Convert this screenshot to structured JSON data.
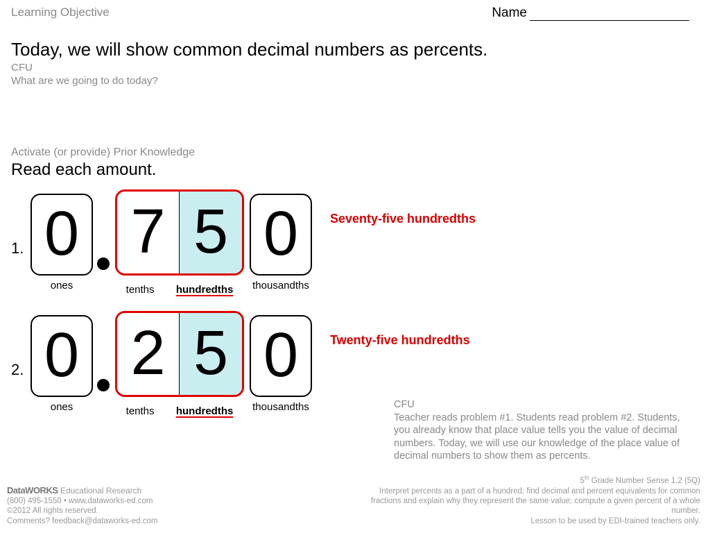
{
  "header": {
    "learning_objective_label": "Learning Objective",
    "name_label": "Name"
  },
  "objective": "Today, we will show common decimal numbers as percents.",
  "cfu1_label": "CFU",
  "cfu1_text": "What are we going to do today?",
  "prior_knowledge_label": "Activate (or provide) Prior Knowledge",
  "read_each": "Read each amount.",
  "problems": [
    {
      "num": "1.",
      "ones": "0",
      "tenths": "7",
      "hundredths": "5",
      "thousandths": "0",
      "labels": {
        "ones": "ones",
        "tenths": "tenths",
        "hundredths": "hundredths",
        "thousandths": "thousandths"
      },
      "words": "Seventy-five hundredths"
    },
    {
      "num": "2.",
      "ones": "0",
      "tenths": "2",
      "hundredths": "5",
      "thousandths": "0",
      "labels": {
        "ones": "ones",
        "tenths": "tenths",
        "hundredths": "hundredths",
        "thousandths": "thousandths"
      },
      "words": "Twenty-five hundredths"
    }
  ],
  "cfu2_label": "CFU",
  "cfu2_text": "Teacher reads problem #1.  Students read problem #2.  Students, you already know that place value tells you the value of decimal numbers.  Today, we will use our knowledge of the place value of decimal numbers to show them as percents.",
  "footer_left": {
    "brand": "DataWORKS",
    "brand_sub": " Educational Research",
    "line2": "(800) 495-1550  •  www.dataworks-ed.com",
    "line3": "©2012 All rights reserved.",
    "line4": "Comments? feedback@dataworks-ed.com"
  },
  "footer_right": {
    "line1_a": "5",
    "line1_b": "th",
    "line1_c": " Grade Number Sense 1.2 (5Q)",
    "line2": "Interpret percents as a part of a hundred; find decimal and percent equivalents for common fractions and explain why they represent the same value; compute a given percent of a whole number.",
    "line3": "Lesson to be used by EDI-trained teachers only."
  }
}
